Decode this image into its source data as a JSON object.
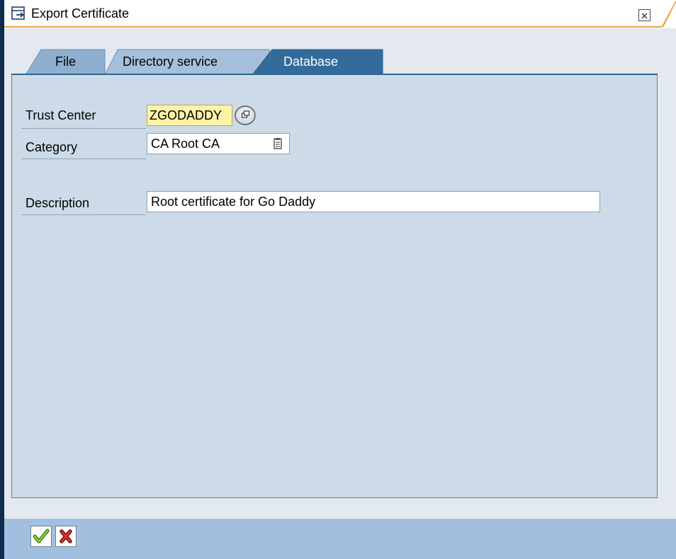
{
  "window": {
    "title": "Export Certificate",
    "title_icon": "export-window-icon",
    "close_icon": "close-icon"
  },
  "tabs": [
    {
      "label": "File",
      "active": false
    },
    {
      "label": "Directory service",
      "active": false
    },
    {
      "label": "Database",
      "active": true
    }
  ],
  "form": {
    "trust_center": {
      "label": "Trust Center",
      "value": "ZGODADDY"
    },
    "category": {
      "label": "Category",
      "value": "CA Root CA"
    },
    "description": {
      "label": "Description",
      "value": "Root certificate for Go Daddy"
    }
  },
  "footer": {
    "confirm_icon": "checkmark-icon",
    "cancel_icon": "cancel-x-icon"
  },
  "colors": {
    "accent_orange": "#f0a43a",
    "active_tab": "#336b9b",
    "panel_bg": "#cddbe8",
    "footer_bg": "#a3bfe0",
    "highlight_field": "#fff4a6"
  }
}
